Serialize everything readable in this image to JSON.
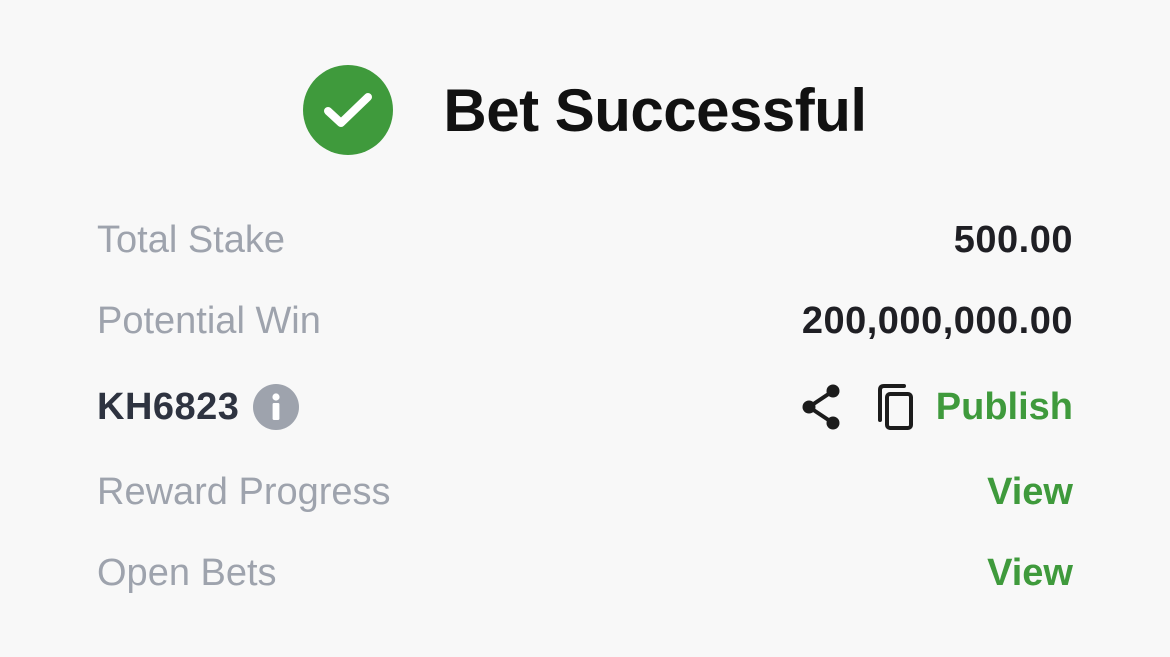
{
  "header": {
    "title": "Bet Successful",
    "status_icon": "check-circle-icon",
    "status_color": "#3f9a3c"
  },
  "summary": {
    "total_stake_label": "Total Stake",
    "total_stake_value": "500.00",
    "potential_win_label": "Potential Win",
    "potential_win_value": "200,000,000.00"
  },
  "booking": {
    "code": "KH6823",
    "info_icon": "info-icon",
    "share_icon": "share-icon",
    "copy_icon": "copy-icon",
    "publish_label": "Publish"
  },
  "links": {
    "reward_progress_label": "Reward Progress",
    "reward_progress_action": "View",
    "open_bets_label": "Open Bets",
    "open_bets_action": "View"
  },
  "colors": {
    "accent_green": "#3f9a3c",
    "muted_text": "#9ea3ad",
    "primary_text": "#1f1f24"
  }
}
